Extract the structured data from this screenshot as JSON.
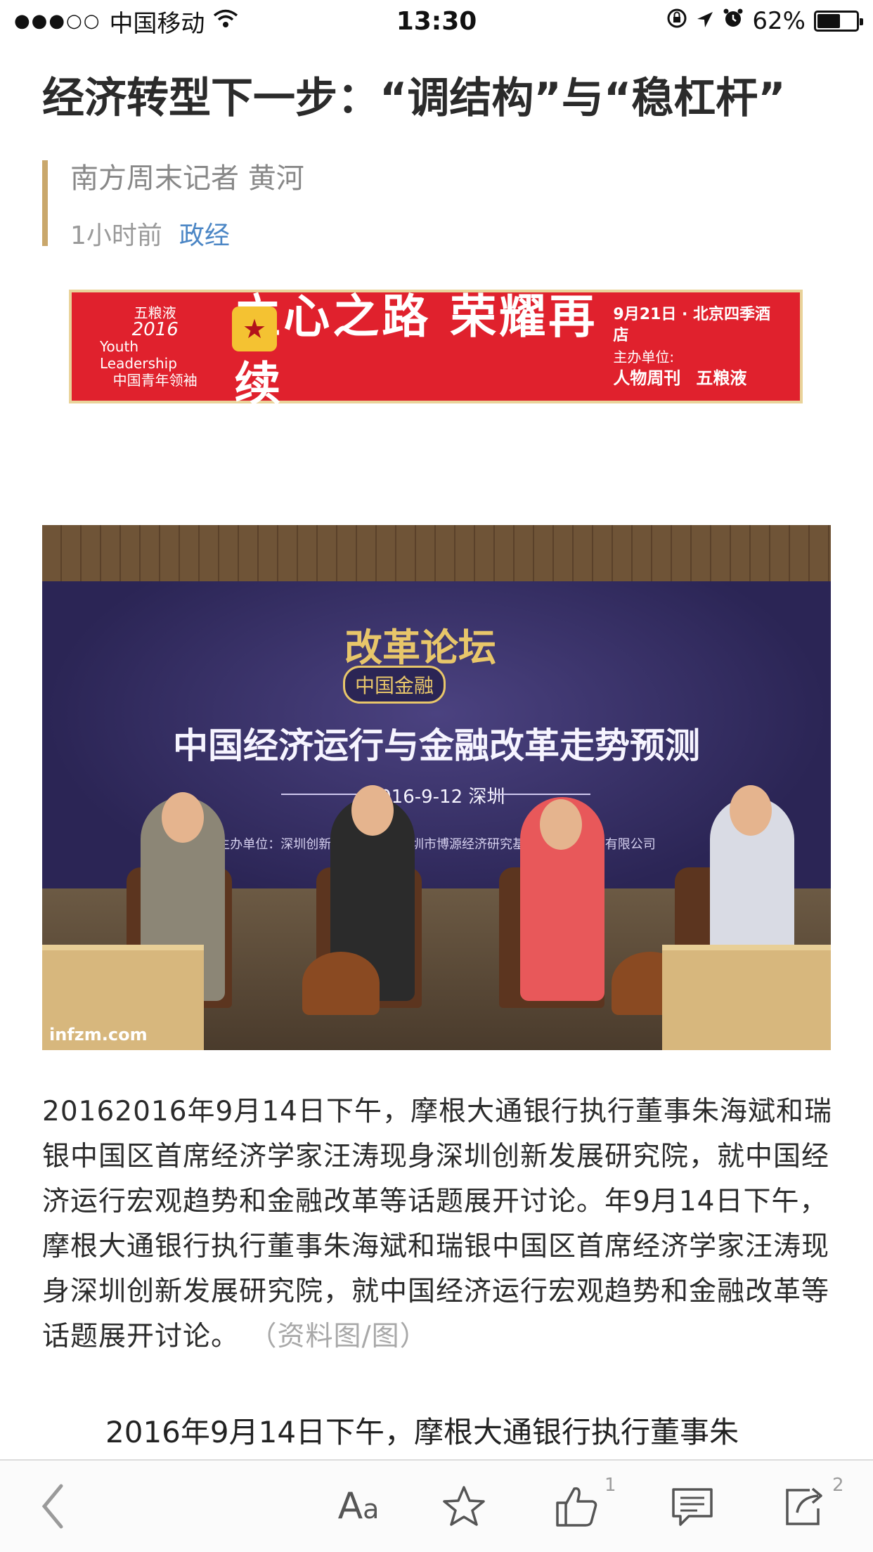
{
  "status_bar": {
    "signal_dots": "●●●○○",
    "carrier": "中国移动",
    "time": "13:30",
    "battery_percent": "62%",
    "battery_level": 0.62,
    "icons": [
      "wifi-icon",
      "orientation-lock-icon",
      "location-arrow-icon",
      "alarm-icon",
      "battery-icon"
    ]
  },
  "article": {
    "title": "经济转型下一步：“调结构”与“稳杠杆”",
    "author": "南方周末记者 黄河",
    "time_ago": "1小时前",
    "category": "政经"
  },
  "ad": {
    "brand": "五粮液",
    "year": "2016",
    "english": "Youth Leadership",
    "program": "中国青年领袖",
    "slogan": "立心之路 荣耀再续",
    "date_venue": "9月21日 · 北京四季酒店",
    "host_label": "主办单位:",
    "sponsor_1": "人物周刊",
    "sponsor_2": "五粮液",
    "colors": {
      "background": "#e0212d",
      "border": "#e9d39a"
    }
  },
  "photo": {
    "forum_tag": "中国金融",
    "forum_name": "改革论坛",
    "headline": "中国经济运行与金融改革走势预测",
    "date_place": "2016-9-12  深圳",
    "organizers": "主办单位：深圳创新发展研究院  深圳市博源经济研究基金会  农业集团有限公司",
    "watermark": "infzm.com"
  },
  "caption": {
    "text": "20162016年9月14日下午，摩根大通银行执行董事朱海斌和瑞银中国区首席经济学家汪涛现身深圳创新发展研究院，就中国经济运行宏观趋势和金融改革等话题展开讨论。年9月14日下午，摩根大通银行执行董事朱海斌和瑞银中国区首席经济学家汪涛现身深圳创新发展研究院，就中国经济运行宏观趋势和金融改革等话题展开讨论。",
    "source": "（资料图/图）"
  },
  "body": {
    "first_line": "2016年9月14日下午，摩根大通银行执行董事朱"
  },
  "toolbar": {
    "font_label_big": "A",
    "font_label_small": "a",
    "like_count": "1",
    "share_count": "2"
  }
}
